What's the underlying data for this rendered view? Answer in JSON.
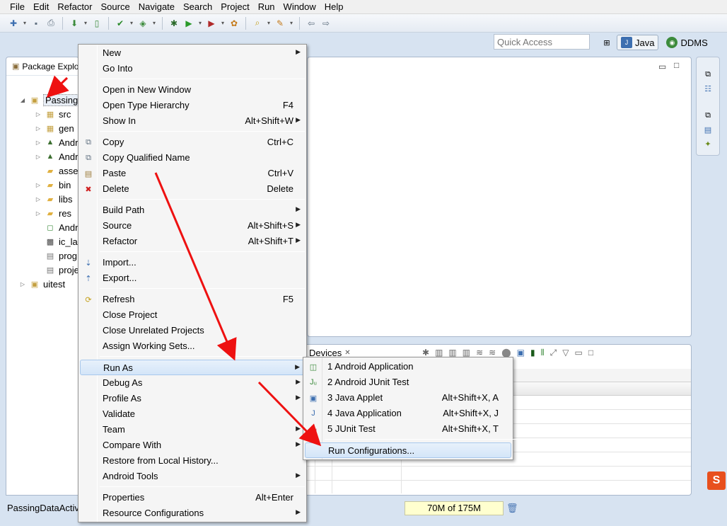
{
  "menubar": [
    "File",
    "Edit",
    "Refactor",
    "Source",
    "Navigate",
    "Search",
    "Project",
    "Run",
    "Window",
    "Help"
  ],
  "toolbar_icons": [
    "new-icon",
    "save-icon",
    "print-icon",
    "android-sdk-icon",
    "avd-icon",
    "check-icon",
    "android-project-icon",
    "debug-icon",
    "run-icon",
    "external-tools-icon",
    "new-class-icon",
    "search-icon",
    "open-type-icon",
    "back-icon",
    "forward-icon"
  ],
  "quick_access": {
    "placeholder": "Quick Access"
  },
  "perspectives": [
    {
      "label": "Java",
      "icon": "java-perspective-icon",
      "active": true
    },
    {
      "label": "DDMS",
      "icon": "ddms-icon",
      "active": false
    }
  ],
  "package_explorer": {
    "tab_label": "Package Explo",
    "items": [
      {
        "label": "Passing",
        "icon": "project-icon",
        "indent": 0,
        "expanded": true
      },
      {
        "label": "src",
        "icon": "package-folder-icon",
        "indent": 1
      },
      {
        "label": "gen",
        "icon": "package-folder-icon",
        "indent": 1
      },
      {
        "label": "Andr",
        "icon": "android-library-icon",
        "indent": 1
      },
      {
        "label": "Andr",
        "icon": "android-library-icon",
        "indent": 1
      },
      {
        "label": "asse",
        "icon": "folder-icon",
        "indent": 1
      },
      {
        "label": "bin",
        "icon": "folder-icon",
        "indent": 1
      },
      {
        "label": "libs",
        "icon": "folder-icon",
        "indent": 1
      },
      {
        "label": "res",
        "icon": "folder-icon",
        "indent": 1
      },
      {
        "label": "Andr",
        "icon": "manifest-file-icon",
        "indent": 1
      },
      {
        "label": "ic_lau",
        "icon": "image-file-icon",
        "indent": 1
      },
      {
        "label": "prog",
        "icon": "text-file-icon",
        "indent": 1
      },
      {
        "label": "proje",
        "icon": "text-file-icon",
        "indent": 1
      },
      {
        "label": "uitest",
        "icon": "project-icon",
        "indent": 0,
        "expanded": false
      }
    ]
  },
  "context_menu": {
    "items": [
      {
        "label": "New",
        "shortcut": "",
        "submenu": true
      },
      {
        "label": "Go Into",
        "shortcut": ""
      },
      {
        "sep": true
      },
      {
        "label": "Open in New Window",
        "shortcut": ""
      },
      {
        "label": "Open Type Hierarchy",
        "shortcut": "F4"
      },
      {
        "label": "Show In",
        "shortcut": "Alt+Shift+W",
        "submenu": true
      },
      {
        "sep": true
      },
      {
        "label": "Copy",
        "shortcut": "Ctrl+C",
        "icon": "copy-icon"
      },
      {
        "label": "Copy Qualified Name",
        "shortcut": "",
        "icon": "copy-qualified-icon"
      },
      {
        "label": "Paste",
        "shortcut": "Ctrl+V",
        "icon": "paste-icon"
      },
      {
        "label": "Delete",
        "shortcut": "Delete",
        "icon": "delete-icon"
      },
      {
        "sep": true
      },
      {
        "label": "Build Path",
        "shortcut": "",
        "submenu": true
      },
      {
        "label": "Source",
        "shortcut": "Alt+Shift+S",
        "submenu": true
      },
      {
        "label": "Refactor",
        "shortcut": "Alt+Shift+T",
        "submenu": true
      },
      {
        "sep": true
      },
      {
        "label": "Import...",
        "shortcut": "",
        "icon": "import-icon"
      },
      {
        "label": "Export...",
        "shortcut": "",
        "icon": "export-icon"
      },
      {
        "sep": true
      },
      {
        "label": "Refresh",
        "shortcut": "F5",
        "icon": "refresh-icon"
      },
      {
        "label": "Close Project",
        "shortcut": ""
      },
      {
        "label": "Close Unrelated Projects",
        "shortcut": ""
      },
      {
        "label": "Assign Working Sets...",
        "shortcut": ""
      },
      {
        "sep": true
      },
      {
        "label": "Run As",
        "shortcut": "",
        "submenu": true,
        "highlight": true
      },
      {
        "label": "Debug As",
        "shortcut": "",
        "submenu": true
      },
      {
        "label": "Profile As",
        "shortcut": "",
        "submenu": true
      },
      {
        "label": "Validate",
        "shortcut": ""
      },
      {
        "label": "Team",
        "shortcut": "",
        "submenu": true
      },
      {
        "label": "Compare With",
        "shortcut": "",
        "submenu": true
      },
      {
        "label": "Restore from Local History...",
        "shortcut": ""
      },
      {
        "label": "Android Tools",
        "shortcut": "",
        "submenu": true
      },
      {
        "sep": true
      },
      {
        "label": "Properties",
        "shortcut": "Alt+Enter"
      },
      {
        "label": "Resource Configurations",
        "shortcut": "",
        "submenu": true
      }
    ]
  },
  "run_as_menu": {
    "items": [
      {
        "label": "1 Android Application",
        "shortcut": "",
        "icon": "android-app-icon"
      },
      {
        "label": "2 Android JUnit Test",
        "shortcut": "",
        "icon": "android-junit-icon"
      },
      {
        "label": "3 Java Applet",
        "shortcut": "Alt+Shift+X, A",
        "icon": "java-applet-icon"
      },
      {
        "label": "4 Java Application",
        "shortcut": "Alt+Shift+X, J",
        "icon": "java-app-icon"
      },
      {
        "label": "5 JUnit Test",
        "shortcut": "Alt+Shift+X, T",
        "icon": "junit-icon"
      },
      {
        "sep": true
      },
      {
        "label": "Run Configurations...",
        "shortcut": "",
        "highlight": true
      }
    ]
  },
  "devices_panel": {
    "tab_label": "Devices",
    "close": "✕"
  },
  "status_bar": {
    "text": "PassingDataActiv",
    "heap": "70M of 175M"
  },
  "ime_badge": "S",
  "colors": {
    "accent_arrow": "#ee1111",
    "highlight": "#d4e5f8",
    "window_bg": "#d7e3f1"
  }
}
